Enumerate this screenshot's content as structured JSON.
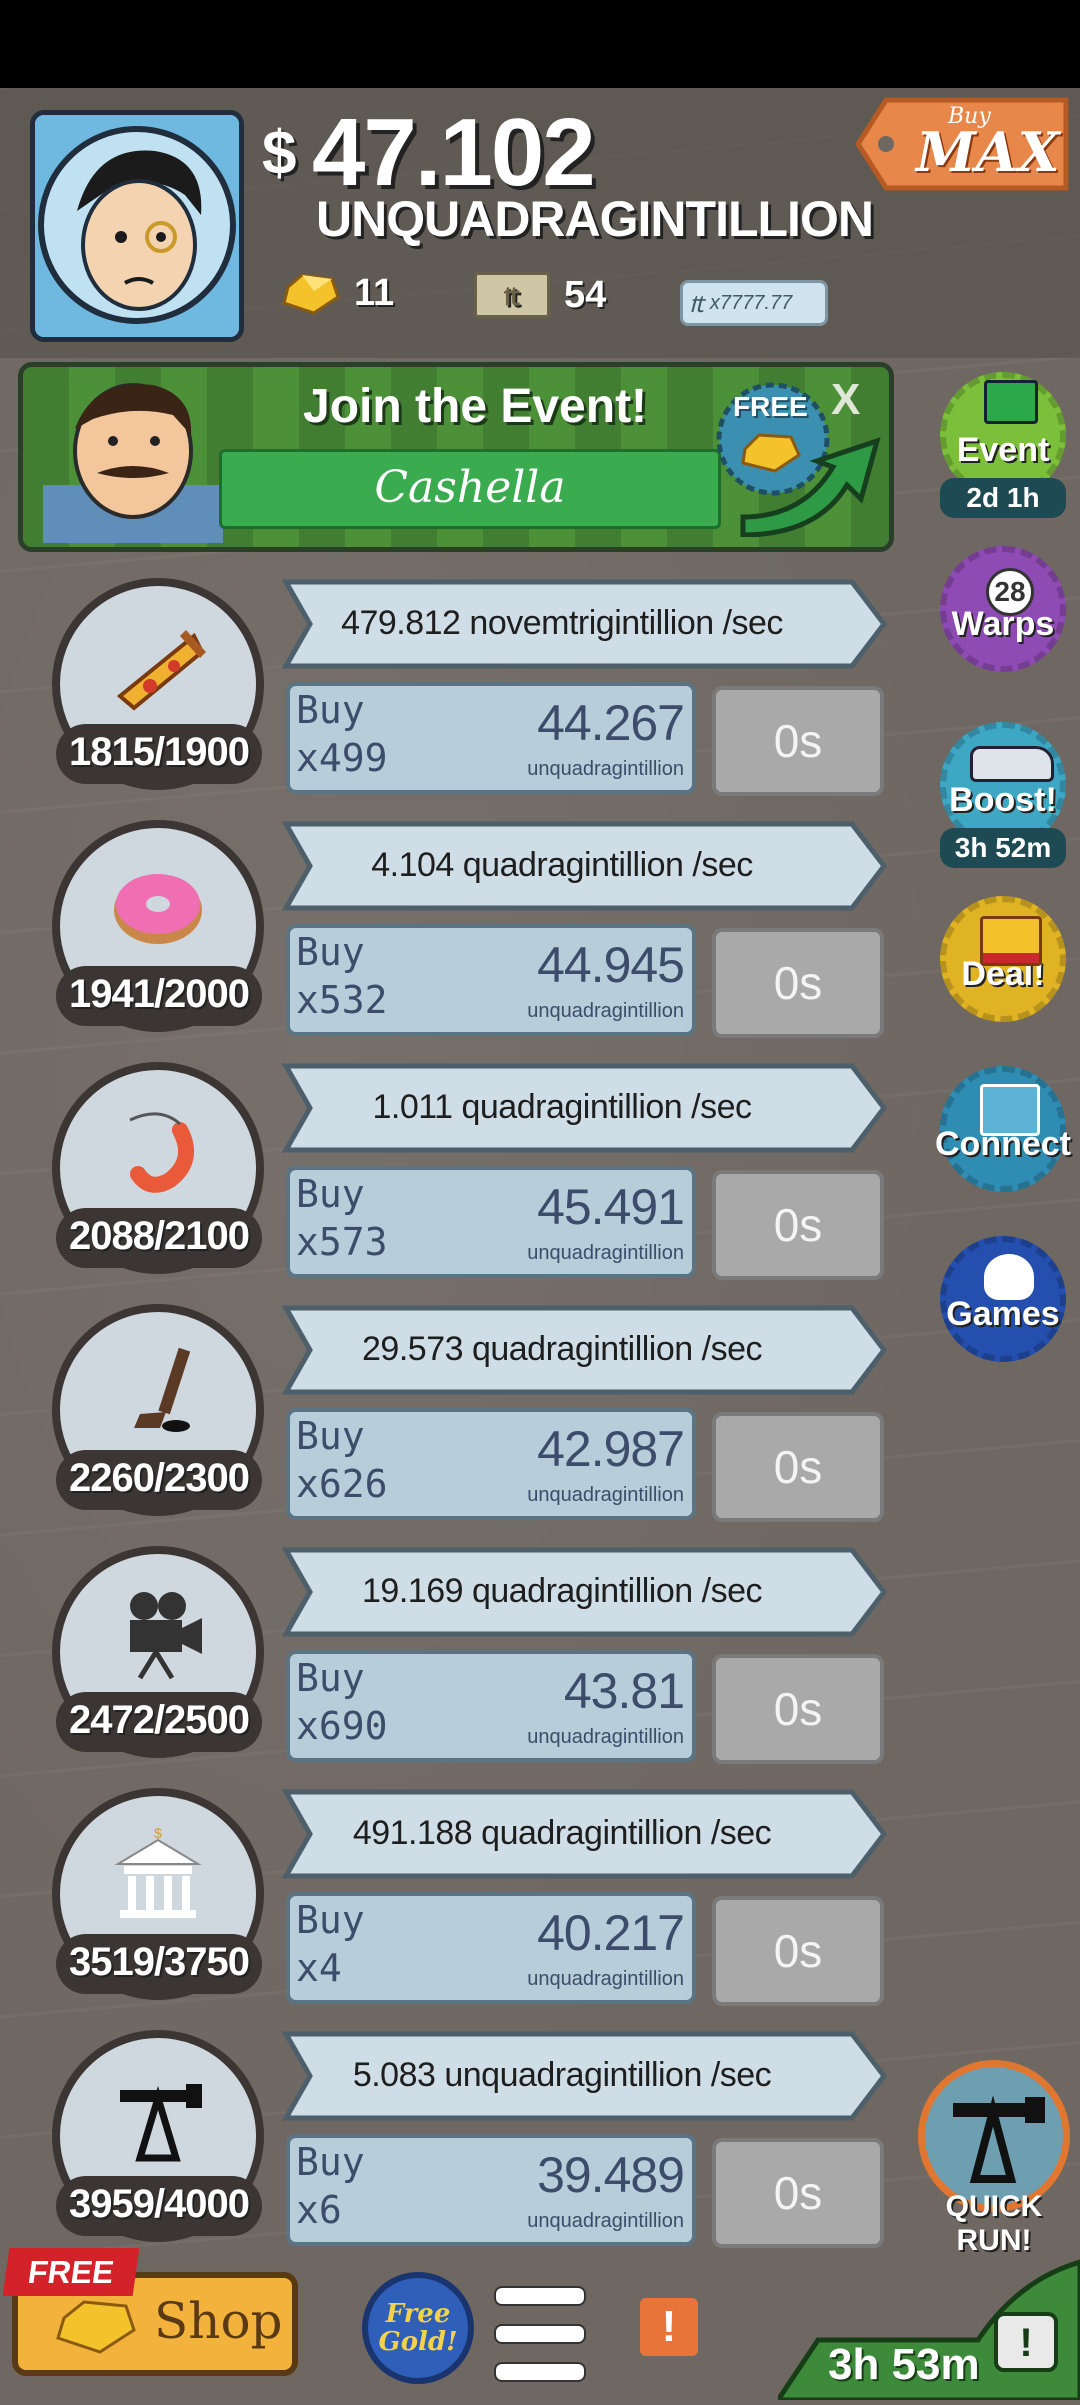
{
  "header": {
    "currency_symbol": "$",
    "money_value": "47.102",
    "money_unit": "UNQUADRAGINTILLION",
    "gold_count": "11",
    "megabucks_count": "54",
    "megaticket_value": "x7777.77",
    "buy_max_small": "Buy",
    "buy_max_big": "MAX"
  },
  "event": {
    "title": "Join the Event!",
    "name": "Cashella",
    "free_label": "FREE",
    "close": "X"
  },
  "side": {
    "event_label": "Event",
    "event_timer": "2d 1h",
    "warps_count": "28",
    "warps_label": "Warps",
    "boost_label": "Boost!",
    "boost_timer": "3h 52m",
    "deal_label": "Deal!",
    "connect_label": "Connect",
    "games_label": "Games"
  },
  "businesses": [
    {
      "icon": "pizza-icon",
      "progress": "1815/1900",
      "progress_fraction": 0.955,
      "rate": "479.812 novemtrigintillion /sec",
      "buy_label": "Buy",
      "buy_qty": "x499",
      "cost": "44.267",
      "cost_unit": "unquadragintillion",
      "timer": "0s"
    },
    {
      "icon": "donut-icon",
      "progress": "1941/2000",
      "progress_fraction": 0.97,
      "rate": "4.104 quadragintillion /sec",
      "buy_label": "Buy",
      "buy_qty": "x532",
      "cost": "44.945",
      "cost_unit": "unquadragintillion",
      "timer": "0s"
    },
    {
      "icon": "shrimp-icon",
      "progress": "2088/2100",
      "progress_fraction": 0.994,
      "rate": "1.011 quadragintillion /sec",
      "buy_label": "Buy",
      "buy_qty": "x573",
      "cost": "45.491",
      "cost_unit": "unquadragintillion",
      "timer": "0s"
    },
    {
      "icon": "hockey-stick-icon",
      "progress": "2260/2300",
      "progress_fraction": 0.983,
      "rate": "29.573 quadragintillion /sec",
      "buy_label": "Buy",
      "buy_qty": "x626",
      "cost": "42.987",
      "cost_unit": "unquadragintillion",
      "timer": "0s"
    },
    {
      "icon": "movie-camera-icon",
      "progress": "2472/2500",
      "progress_fraction": 0.989,
      "rate": "19.169 quadragintillion /sec",
      "buy_label": "Buy",
      "buy_qty": "x690",
      "cost": "43.81",
      "cost_unit": "unquadragintillion",
      "timer": "0s"
    },
    {
      "icon": "bank-icon",
      "progress": "3519/3750",
      "progress_fraction": 0.938,
      "rate": "491.188 quadragintillion /sec",
      "buy_label": "Buy",
      "buy_qty": "x4",
      "cost": "40.217",
      "cost_unit": "unquadragintillion",
      "timer": "0s"
    },
    {
      "icon": "oil-rig-icon",
      "progress": "3959/4000",
      "progress_fraction": 0.99,
      "rate": "5.083 unquadragintillion /sec",
      "buy_label": "Buy",
      "buy_qty": "x6",
      "cost": "39.489",
      "cost_unit": "unquadragintillion",
      "timer": "0s"
    }
  ],
  "quick_run": "QUICK RUN!",
  "bottom": {
    "free_ribbon": "FREE",
    "shop_label": "Shop",
    "free_gold_line1": "Free",
    "free_gold_line2": "Gold!",
    "alert": "!",
    "run_timer": "3h 53m"
  }
}
